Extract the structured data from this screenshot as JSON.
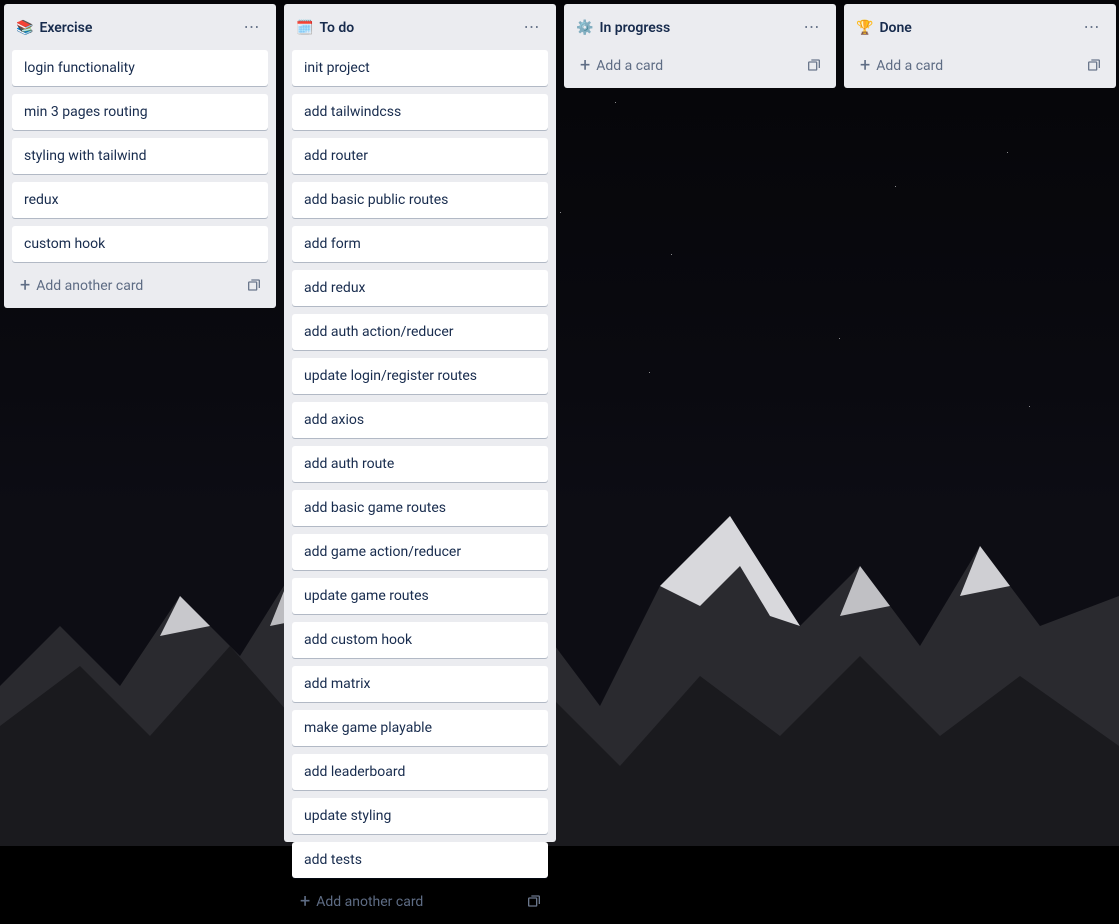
{
  "lists": [
    {
      "emoji": "📚",
      "title": "Exercise",
      "add_label": "Add another card",
      "cards": [
        "login functionality",
        "min 3 pages routing",
        "styling with tailwind",
        "redux",
        "custom hook"
      ]
    },
    {
      "emoji": "🗓️",
      "title": "To do",
      "add_label": "Add another card",
      "cards": [
        "init project",
        "add tailwindcss",
        "add router",
        "add basic public routes",
        "add form",
        "add redux",
        "add auth action/reducer",
        "update login/register routes",
        "add axios",
        "add auth route",
        "add basic game routes",
        "add game action/reducer",
        "update game routes",
        "add custom hook",
        "add matrix",
        "make game playable",
        "add leaderboard",
        "update styling",
        "add tests"
      ]
    },
    {
      "emoji": "⚙️",
      "title": "In progress",
      "add_label": "Add a card",
      "cards": []
    },
    {
      "emoji": "🏆",
      "title": "Done",
      "add_label": "Add a card",
      "cards": []
    }
  ]
}
